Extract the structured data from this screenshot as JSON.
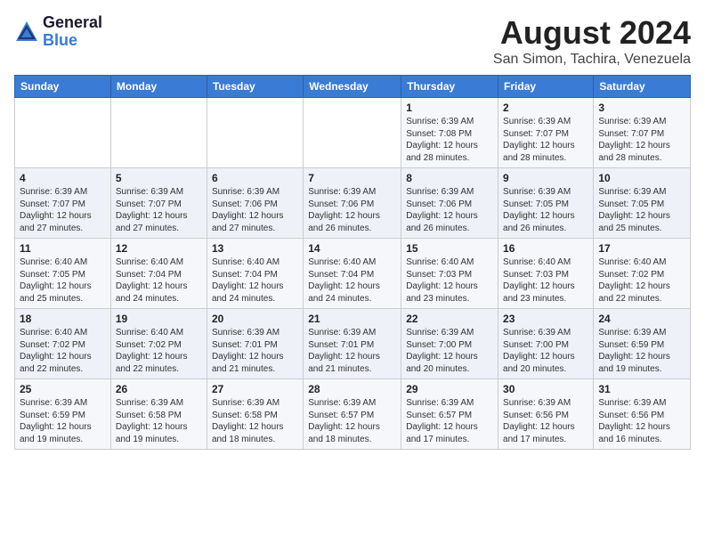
{
  "header": {
    "logo_general": "General",
    "logo_blue": "Blue",
    "title": "August 2024",
    "location": "San Simon, Tachira, Venezuela"
  },
  "calendar": {
    "days_of_week": [
      "Sunday",
      "Monday",
      "Tuesday",
      "Wednesday",
      "Thursday",
      "Friday",
      "Saturday"
    ],
    "weeks": [
      [
        {
          "day": "",
          "info": ""
        },
        {
          "day": "",
          "info": ""
        },
        {
          "day": "",
          "info": ""
        },
        {
          "day": "",
          "info": ""
        },
        {
          "day": "1",
          "info": "Sunrise: 6:39 AM\nSunset: 7:08 PM\nDaylight: 12 hours\nand 28 minutes."
        },
        {
          "day": "2",
          "info": "Sunrise: 6:39 AM\nSunset: 7:07 PM\nDaylight: 12 hours\nand 28 minutes."
        },
        {
          "day": "3",
          "info": "Sunrise: 6:39 AM\nSunset: 7:07 PM\nDaylight: 12 hours\nand 28 minutes."
        }
      ],
      [
        {
          "day": "4",
          "info": "Sunrise: 6:39 AM\nSunset: 7:07 PM\nDaylight: 12 hours\nand 27 minutes."
        },
        {
          "day": "5",
          "info": "Sunrise: 6:39 AM\nSunset: 7:07 PM\nDaylight: 12 hours\nand 27 minutes."
        },
        {
          "day": "6",
          "info": "Sunrise: 6:39 AM\nSunset: 7:06 PM\nDaylight: 12 hours\nand 27 minutes."
        },
        {
          "day": "7",
          "info": "Sunrise: 6:39 AM\nSunset: 7:06 PM\nDaylight: 12 hours\nand 26 minutes."
        },
        {
          "day": "8",
          "info": "Sunrise: 6:39 AM\nSunset: 7:06 PM\nDaylight: 12 hours\nand 26 minutes."
        },
        {
          "day": "9",
          "info": "Sunrise: 6:39 AM\nSunset: 7:05 PM\nDaylight: 12 hours\nand 26 minutes."
        },
        {
          "day": "10",
          "info": "Sunrise: 6:39 AM\nSunset: 7:05 PM\nDaylight: 12 hours\nand 25 minutes."
        }
      ],
      [
        {
          "day": "11",
          "info": "Sunrise: 6:40 AM\nSunset: 7:05 PM\nDaylight: 12 hours\nand 25 minutes."
        },
        {
          "day": "12",
          "info": "Sunrise: 6:40 AM\nSunset: 7:04 PM\nDaylight: 12 hours\nand 24 minutes."
        },
        {
          "day": "13",
          "info": "Sunrise: 6:40 AM\nSunset: 7:04 PM\nDaylight: 12 hours\nand 24 minutes."
        },
        {
          "day": "14",
          "info": "Sunrise: 6:40 AM\nSunset: 7:04 PM\nDaylight: 12 hours\nand 24 minutes."
        },
        {
          "day": "15",
          "info": "Sunrise: 6:40 AM\nSunset: 7:03 PM\nDaylight: 12 hours\nand 23 minutes."
        },
        {
          "day": "16",
          "info": "Sunrise: 6:40 AM\nSunset: 7:03 PM\nDaylight: 12 hours\nand 23 minutes."
        },
        {
          "day": "17",
          "info": "Sunrise: 6:40 AM\nSunset: 7:02 PM\nDaylight: 12 hours\nand 22 minutes."
        }
      ],
      [
        {
          "day": "18",
          "info": "Sunrise: 6:40 AM\nSunset: 7:02 PM\nDaylight: 12 hours\nand 22 minutes."
        },
        {
          "day": "19",
          "info": "Sunrise: 6:40 AM\nSunset: 7:02 PM\nDaylight: 12 hours\nand 22 minutes."
        },
        {
          "day": "20",
          "info": "Sunrise: 6:39 AM\nSunset: 7:01 PM\nDaylight: 12 hours\nand 21 minutes."
        },
        {
          "day": "21",
          "info": "Sunrise: 6:39 AM\nSunset: 7:01 PM\nDaylight: 12 hours\nand 21 minutes."
        },
        {
          "day": "22",
          "info": "Sunrise: 6:39 AM\nSunset: 7:00 PM\nDaylight: 12 hours\nand 20 minutes."
        },
        {
          "day": "23",
          "info": "Sunrise: 6:39 AM\nSunset: 7:00 PM\nDaylight: 12 hours\nand 20 minutes."
        },
        {
          "day": "24",
          "info": "Sunrise: 6:39 AM\nSunset: 6:59 PM\nDaylight: 12 hours\nand 19 minutes."
        }
      ],
      [
        {
          "day": "25",
          "info": "Sunrise: 6:39 AM\nSunset: 6:59 PM\nDaylight: 12 hours\nand 19 minutes."
        },
        {
          "day": "26",
          "info": "Sunrise: 6:39 AM\nSunset: 6:58 PM\nDaylight: 12 hours\nand 19 minutes."
        },
        {
          "day": "27",
          "info": "Sunrise: 6:39 AM\nSunset: 6:58 PM\nDaylight: 12 hours\nand 18 minutes."
        },
        {
          "day": "28",
          "info": "Sunrise: 6:39 AM\nSunset: 6:57 PM\nDaylight: 12 hours\nand 18 minutes."
        },
        {
          "day": "29",
          "info": "Sunrise: 6:39 AM\nSunset: 6:57 PM\nDaylight: 12 hours\nand 17 minutes."
        },
        {
          "day": "30",
          "info": "Sunrise: 6:39 AM\nSunset: 6:56 PM\nDaylight: 12 hours\nand 17 minutes."
        },
        {
          "day": "31",
          "info": "Sunrise: 6:39 AM\nSunset: 6:56 PM\nDaylight: 12 hours\nand 16 minutes."
        }
      ]
    ]
  }
}
